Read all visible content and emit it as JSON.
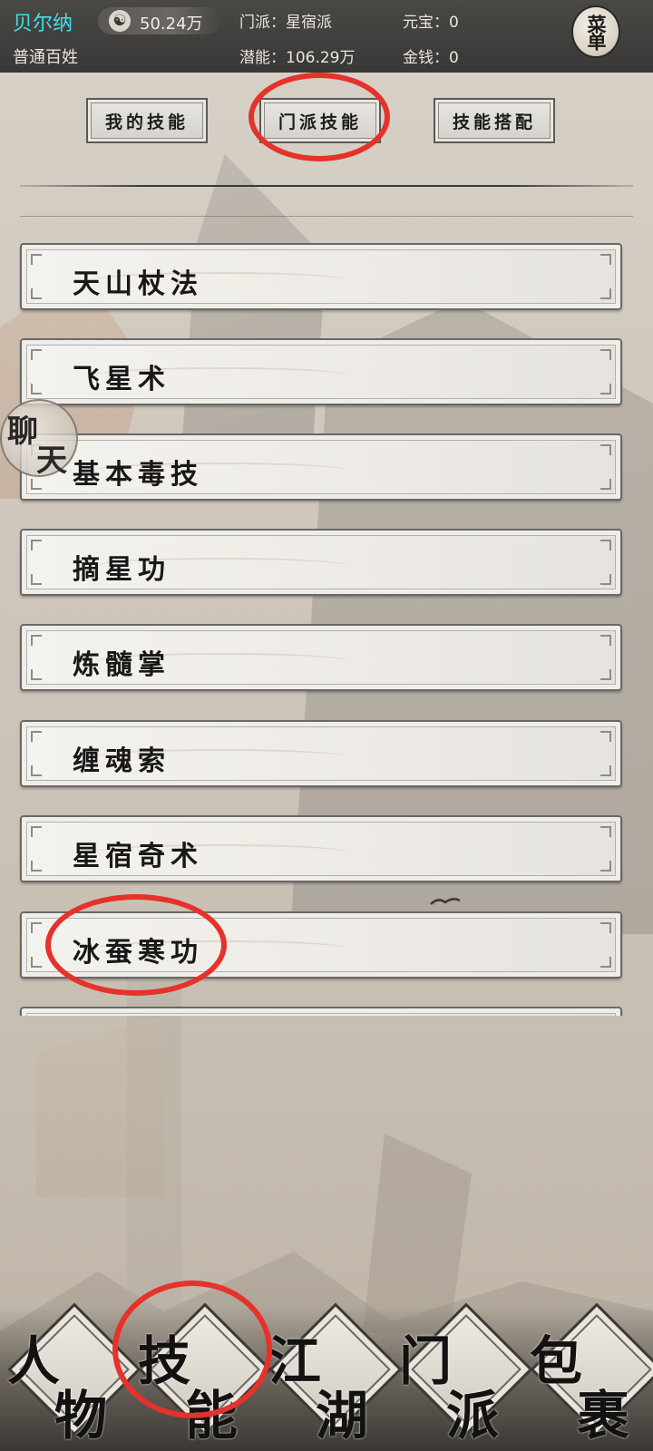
{
  "header": {
    "player_name": "贝尔纳",
    "player_rank": "普通百姓",
    "silver_icon": "☯",
    "silver_value": "50.24万",
    "sect": "门派：星宿派",
    "potential": "潜能：106.29万",
    "ingot": "元宝：0",
    "money": "金钱：0",
    "menu_label": "菜单"
  },
  "tabs": [
    {
      "label": "我的技能"
    },
    {
      "label": "门派技能"
    },
    {
      "label": "技能搭配"
    }
  ],
  "skills": [
    {
      "name": "天山杖法"
    },
    {
      "name": "飞星术"
    },
    {
      "name": "基本毒技"
    },
    {
      "name": "摘星功"
    },
    {
      "name": "炼髓掌"
    },
    {
      "name": "缠魂索"
    },
    {
      "name": "星宿奇术"
    },
    {
      "name": "冰蚕寒功"
    }
  ],
  "chat": {
    "char1": "聊",
    "char2": "天"
  },
  "bottom_nav": [
    {
      "c1": "人",
      "c2": "物"
    },
    {
      "c1": "技",
      "c2": "能"
    },
    {
      "c1": "江",
      "c2": "湖"
    },
    {
      "c1": "门",
      "c2": "派"
    },
    {
      "c1": "包",
      "c2": "裹"
    }
  ],
  "colors": {
    "player_name": "#3ee0e6",
    "annotation_red": "#e5322b",
    "header_bg": "#3a3836"
  }
}
